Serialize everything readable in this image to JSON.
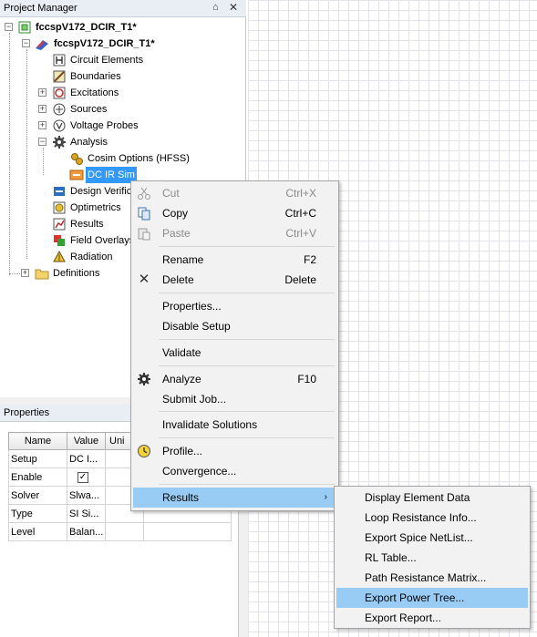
{
  "project_manager": {
    "title": "Project Manager",
    "pin_glyph": "⌂",
    "close_glyph": "✕",
    "tree": {
      "project": "fccspV172_DCIR_T1*",
      "design": "fccspV172_DCIR_T1*",
      "circuit_elements": "Circuit Elements",
      "boundaries": "Boundaries",
      "excitations": "Excitations",
      "sources": "Sources",
      "voltage_probes": "Voltage Probes",
      "analysis": "Analysis",
      "cosim_options": "Cosim Options (HFSS)",
      "dc_ir_sim": "DC IR Sim",
      "design_verification": "Design Verific",
      "optimetrics": "Optimetrics",
      "results": "Results",
      "field_overlays": "Field Overlays",
      "radiation": "Radiation",
      "definitions": "Definitions"
    }
  },
  "properties": {
    "title": "Properties",
    "columns": [
      "Name",
      "Value",
      "Uni"
    ],
    "rows": [
      {
        "name": "Setup",
        "value": "DC I..."
      },
      {
        "name": "Enable",
        "value": "✓"
      },
      {
        "name": "Solver",
        "value": "Slwa..."
      },
      {
        "name": "Type",
        "value": "SI Si..."
      },
      {
        "name": "Level",
        "value": "Balan..."
      }
    ]
  },
  "context_menu": {
    "cut": {
      "label": "Cut",
      "shortcut": "Ctrl+X"
    },
    "copy": {
      "label": "Copy",
      "shortcut": "Ctrl+C"
    },
    "paste": {
      "label": "Paste",
      "shortcut": "Ctrl+V"
    },
    "rename": {
      "label": "Rename",
      "shortcut": "F2"
    },
    "delete": {
      "label": "Delete",
      "shortcut": "Delete"
    },
    "properties": {
      "label": "Properties..."
    },
    "disable_setup": {
      "label": "Disable Setup"
    },
    "validate": {
      "label": "Validate"
    },
    "analyze": {
      "label": "Analyze",
      "shortcut": "F10"
    },
    "submit_job": {
      "label": "Submit Job..."
    },
    "invalidate": {
      "label": "Invalidate Solutions"
    },
    "profile": {
      "label": "Profile..."
    },
    "convergence": {
      "label": "Convergence..."
    },
    "results": {
      "label": "Results",
      "arrow": "›"
    },
    "delete_glyph": "✕"
  },
  "results_submenu": [
    "Display Element Data",
    "Loop Resistance Info...",
    "Export Spice NetList...",
    "RL Table...",
    "Path Resistance Matrix...",
    "Export Power Tree...",
    "Export Report..."
  ],
  "colors": {
    "selection": "#3399ff",
    "menu_highlight": "#99ccf5"
  }
}
